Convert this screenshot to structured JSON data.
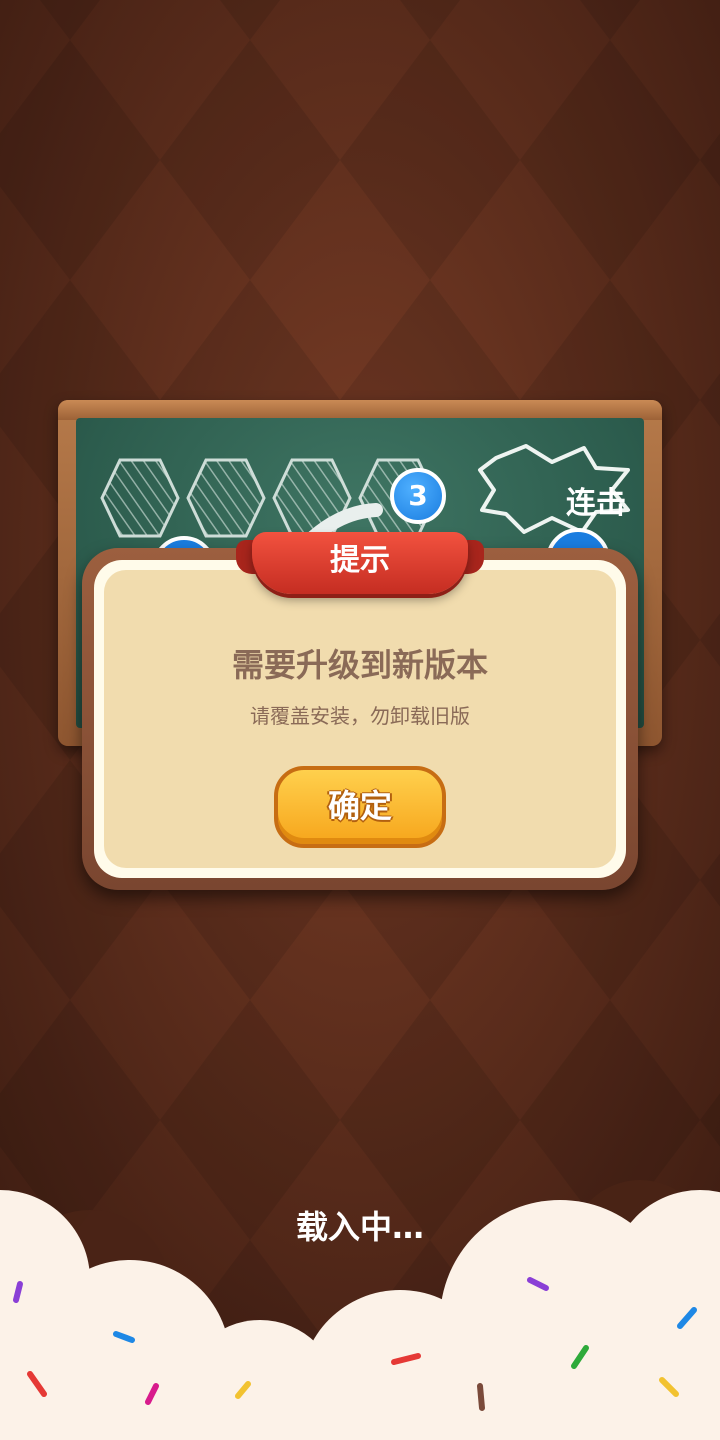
{
  "board": {
    "combo_label": "连击",
    "bubble_number": "3"
  },
  "dialog": {
    "ribbon_title": "提示",
    "title": "需要升级到新版本",
    "subtitle": "请覆盖安装，勿卸载旧版",
    "confirm_label": "确定"
  },
  "loading_text": "载入中…",
  "colors": {
    "background": "#5a2c1c",
    "chalkboard": "#2c5c4d",
    "ribbon": "#e0412f",
    "button": "#f6a51b",
    "dialog_panel": "#f1dcae"
  }
}
